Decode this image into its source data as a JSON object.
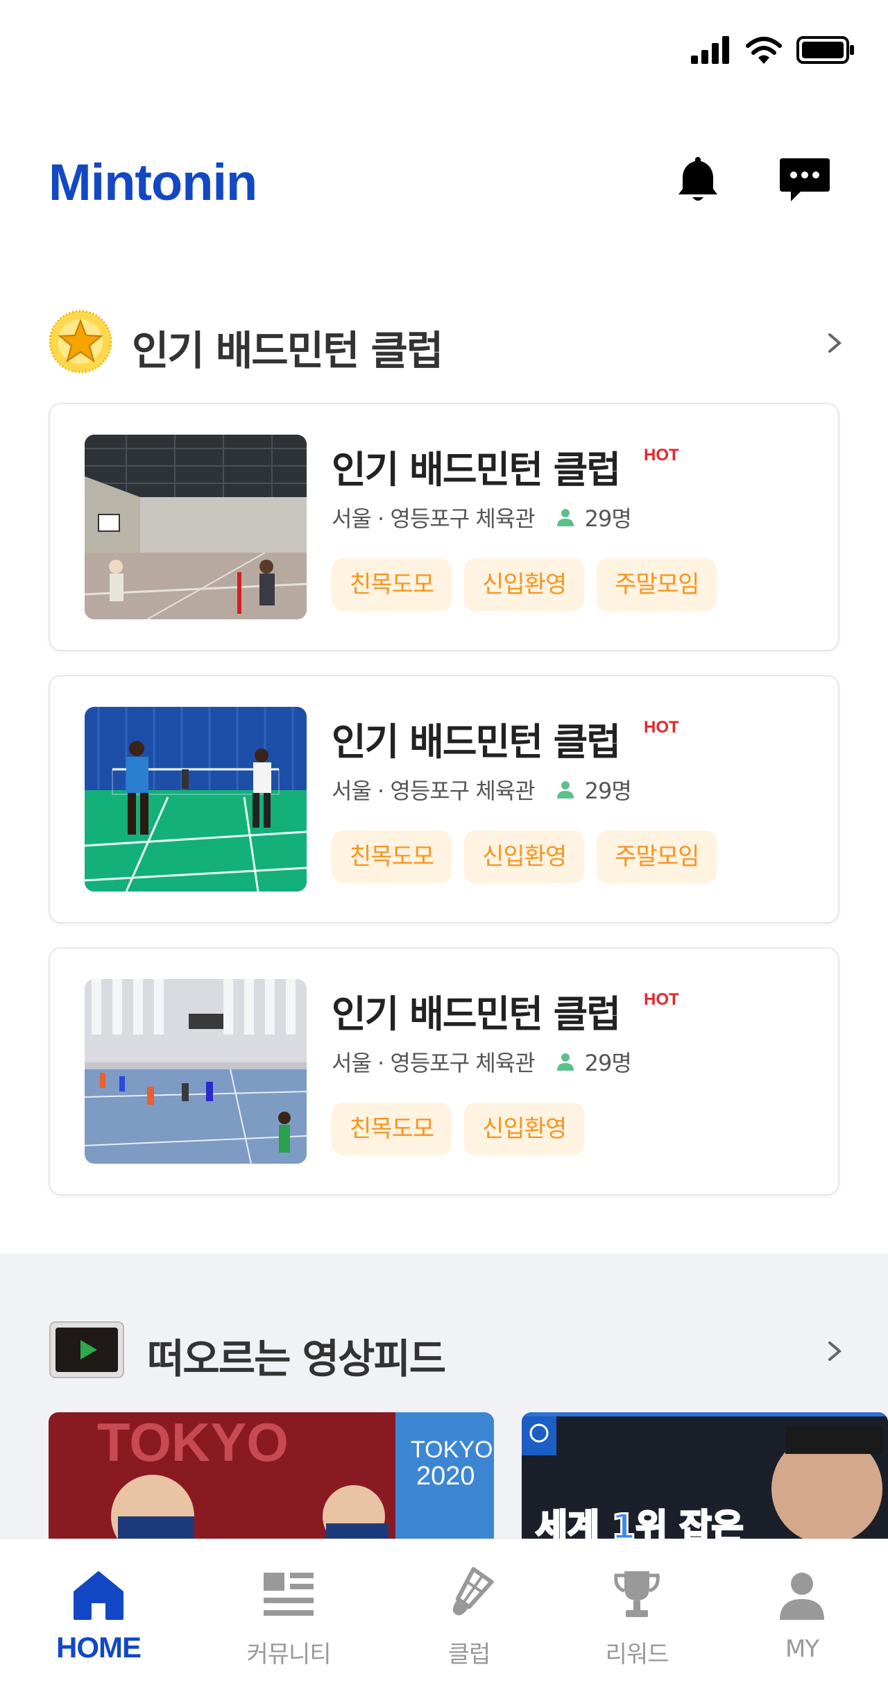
{
  "app": {
    "title": "Mintonin"
  },
  "popular_section": {
    "title": "인기 배드민턴 클럽",
    "clubs": [
      {
        "name": "인기 배드민턴 클럽",
        "badge": "HOT",
        "location": "서울 · 영등포구 체육관",
        "members": "29명",
        "tags": [
          "친목도모",
          "신입환영",
          "주말모임"
        ]
      },
      {
        "name": "인기 배드민턴 클럽",
        "badge": "HOT",
        "location": "서울 · 영등포구 체육관",
        "members": "29명",
        "tags": [
          "친목도모",
          "신입환영",
          "주말모임"
        ]
      },
      {
        "name": "인기 배드민턴 클럽",
        "badge": "HOT",
        "location": "서울 · 영등포구 체육관",
        "members": "29명",
        "tags": [
          "친목도모",
          "신입환영"
        ]
      }
    ]
  },
  "video_section": {
    "title": "떠오르는 영상피드",
    "videos": [
      {
        "overlay_text": "TOKYO",
        "badge_line1": "TOKYO",
        "badge_line2": "2020"
      },
      {
        "overlay_text": "세계 1위 잡은"
      }
    ]
  },
  "bottom_nav": {
    "items": [
      {
        "label": "HOME",
        "icon": "home-icon",
        "active": true
      },
      {
        "label": "커뮤니티",
        "icon": "community-icon",
        "active": false
      },
      {
        "label": "클럽",
        "icon": "shuttlecock-icon",
        "active": false
      },
      {
        "label": "리워드",
        "icon": "trophy-icon",
        "active": false
      },
      {
        "label": "MY",
        "icon": "person-icon",
        "active": false
      }
    ]
  },
  "colors": {
    "brand": "#1348c4",
    "hot": "#e8242b",
    "tag_text": "#f7951e",
    "tag_bg": "#fff3e2",
    "member_icon": "#5cc08a"
  }
}
